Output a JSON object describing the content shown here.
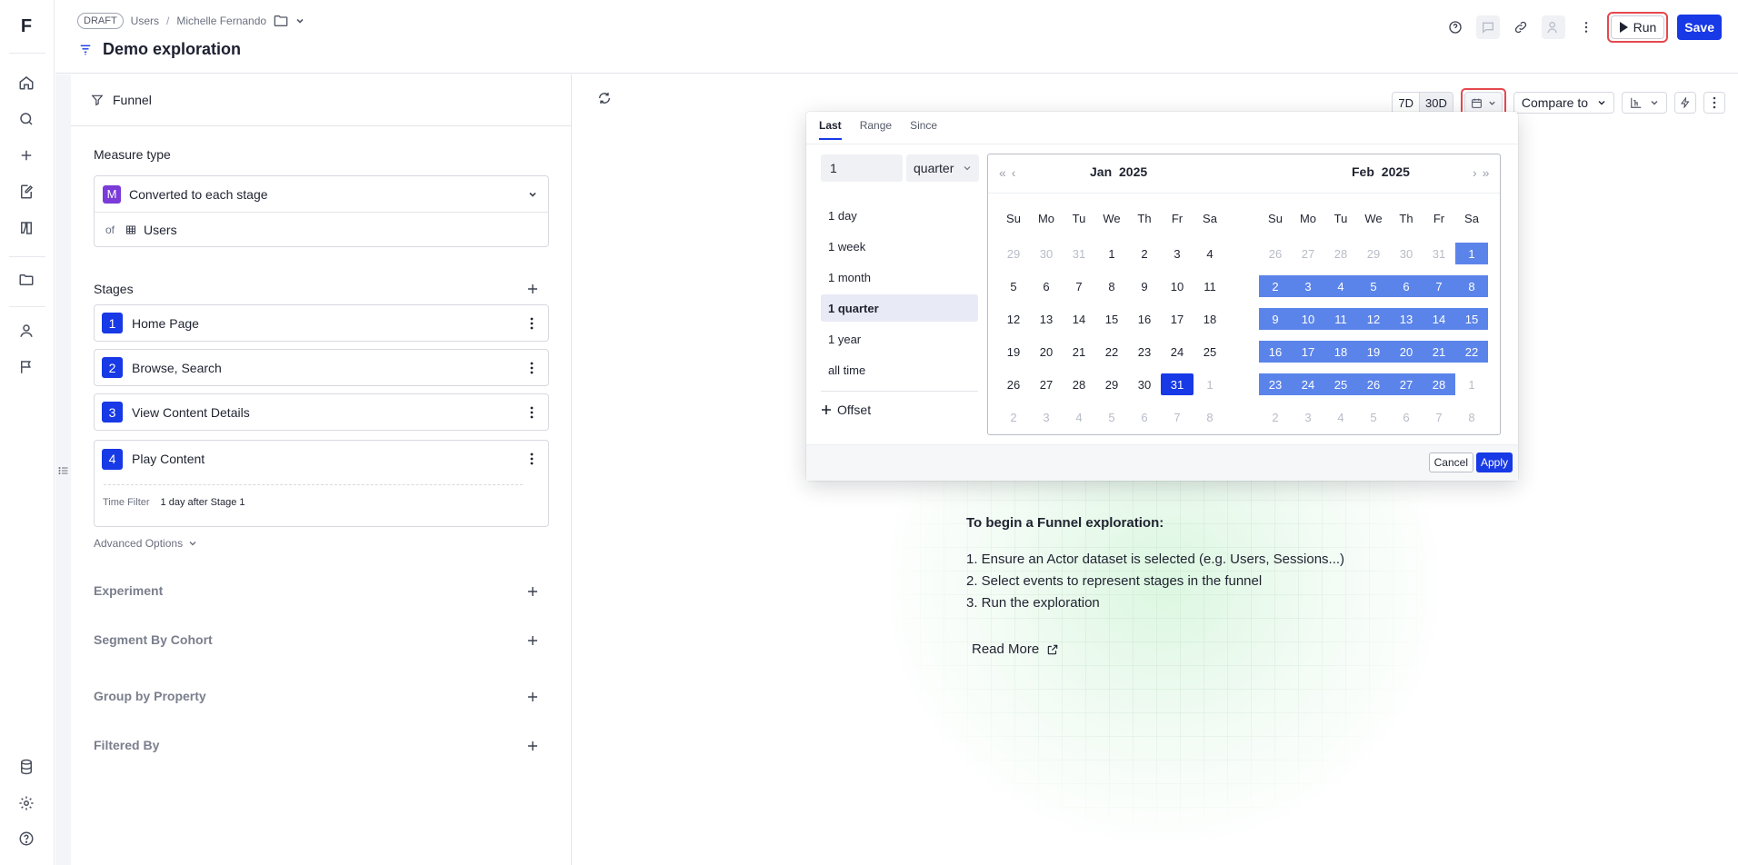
{
  "app": {
    "logo_letter": "F"
  },
  "rail": {
    "items": [
      "home-icon",
      "search-icon",
      "plus-icon",
      "edit-icon",
      "beaker-icon",
      "folder-icon",
      "user-icon",
      "flag-icon"
    ],
    "bottom": [
      "database-icon",
      "gear-icon",
      "help-icon"
    ]
  },
  "header": {
    "badge": "DRAFT",
    "crumb_1": "Users",
    "separator": "/",
    "crumb_2": "Michelle Fernando",
    "title": "Demo exploration",
    "run_label": "Run",
    "save_label": "Save"
  },
  "panel": {
    "head_title": "Funnel",
    "measure_label": "Measure type",
    "measure_badge": "M",
    "measure_value": "Converted to each stage",
    "of_label": "of",
    "of_value": "Users",
    "stages_label": "Stages",
    "stages": [
      {
        "num": "1",
        "label": "Home Page"
      },
      {
        "num": "2",
        "label": "Browse, Search"
      },
      {
        "num": "3",
        "label": "View Content Details"
      },
      {
        "num": "4",
        "label": "Play Content"
      }
    ],
    "time_filter_label": "Time Filter",
    "time_filter_value": "1 day after Stage 1",
    "advanced": "Advanced Options",
    "sections": [
      "Experiment",
      "Segment By Cohort",
      "Group by Property",
      "Filtered By"
    ]
  },
  "toolbar": {
    "d7": "7D",
    "d30": "30D",
    "compare": "Compare to"
  },
  "howto": {
    "heading": "To begin a Funnel exploration:",
    "steps": [
      "1. Ensure an Actor dataset is selected (e.g. Users, Sessions...)",
      "2. Select events to represent stages in the funnel",
      "3. Run the exploration"
    ],
    "read_more": "Read More"
  },
  "datepicker": {
    "tabs": [
      "Last",
      "Range",
      "Since"
    ],
    "active_tab": "Last",
    "count": "1",
    "unit": "quarter",
    "presets": [
      "1 day",
      "1 week",
      "1 month",
      "1 quarter",
      "1 year",
      "all time"
    ],
    "selected_preset": "1 quarter",
    "offset": "Offset",
    "weekdays": [
      "Su",
      "Mo",
      "Tu",
      "We",
      "Th",
      "Fr",
      "Sa"
    ],
    "months": [
      {
        "title": "Jan  2025",
        "weeks": [
          [
            "29",
            "30",
            "31",
            "1",
            "2",
            "3",
            "4"
          ],
          [
            "5",
            "6",
            "7",
            "8",
            "9",
            "10",
            "11"
          ],
          [
            "12",
            "13",
            "14",
            "15",
            "16",
            "17",
            "18"
          ],
          [
            "19",
            "20",
            "21",
            "22",
            "23",
            "24",
            "25"
          ],
          [
            "26",
            "27",
            "28",
            "29",
            "30",
            "31",
            "1"
          ],
          [
            "2",
            "3",
            "4",
            "5",
            "6",
            "7",
            "8"
          ]
        ]
      },
      {
        "title": "Feb  2025",
        "weeks": [
          [
            "26",
            "27",
            "28",
            "29",
            "30",
            "31",
            "1"
          ],
          [
            "2",
            "3",
            "4",
            "5",
            "6",
            "7",
            "8"
          ],
          [
            "9",
            "10",
            "11",
            "12",
            "13",
            "14",
            "15"
          ],
          [
            "16",
            "17",
            "18",
            "19",
            "20",
            "21",
            "22"
          ],
          [
            "23",
            "24",
            "25",
            "26",
            "27",
            "28",
            "1"
          ],
          [
            "2",
            "3",
            "4",
            "5",
            "6",
            "7",
            "8"
          ]
        ]
      }
    ],
    "range_start": "2025-01-31",
    "range_end": "2025-03-01",
    "cancel": "Cancel",
    "apply": "Apply"
  }
}
